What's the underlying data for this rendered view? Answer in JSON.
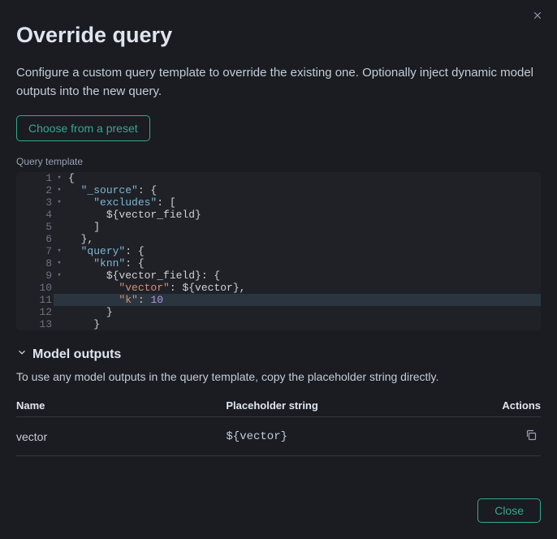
{
  "header": {
    "title": "Override query",
    "description": "Configure a custom query template to override the existing one. Optionally inject dynamic model outputs into the new query.",
    "preset_button_label": "Choose from a preset"
  },
  "editor": {
    "label": "Query template",
    "highlighted_line": 11,
    "lines": [
      {
        "n": 1,
        "foldable": true,
        "indent": 0,
        "tokens": [
          {
            "t": "{",
            "c": "plain"
          }
        ]
      },
      {
        "n": 2,
        "foldable": true,
        "indent": 1,
        "tokens": [
          {
            "t": "\"_source\"",
            "c": "key"
          },
          {
            "t": ": {",
            "c": "plain"
          }
        ]
      },
      {
        "n": 3,
        "foldable": true,
        "indent": 2,
        "tokens": [
          {
            "t": "\"excludes\"",
            "c": "key"
          },
          {
            "t": ": [",
            "c": "plain"
          }
        ]
      },
      {
        "n": 4,
        "foldable": false,
        "indent": 3,
        "tokens": [
          {
            "t": "${vector_field}",
            "c": "plain"
          }
        ]
      },
      {
        "n": 5,
        "foldable": false,
        "indent": 2,
        "tokens": [
          {
            "t": "]",
            "c": "plain"
          }
        ]
      },
      {
        "n": 6,
        "foldable": false,
        "indent": 1,
        "tokens": [
          {
            "t": "},",
            "c": "plain"
          }
        ]
      },
      {
        "n": 7,
        "foldable": true,
        "indent": 1,
        "tokens": [
          {
            "t": "\"query\"",
            "c": "key"
          },
          {
            "t": ": {",
            "c": "plain"
          }
        ]
      },
      {
        "n": 8,
        "foldable": true,
        "indent": 2,
        "tokens": [
          {
            "t": "\"knn\"",
            "c": "key"
          },
          {
            "t": ": {",
            "c": "plain"
          }
        ]
      },
      {
        "n": 9,
        "foldable": true,
        "indent": 3,
        "tokens": [
          {
            "t": "${vector_field}: {",
            "c": "plain"
          }
        ]
      },
      {
        "n": 10,
        "foldable": false,
        "indent": 4,
        "tokens": [
          {
            "t": "\"vector\"",
            "c": "str"
          },
          {
            "t": ": ${vector},",
            "c": "plain"
          }
        ]
      },
      {
        "n": 11,
        "foldable": false,
        "indent": 4,
        "tokens": [
          {
            "t": "\"k\"",
            "c": "str"
          },
          {
            "t": ": ",
            "c": "plain"
          },
          {
            "t": "10",
            "c": "num"
          }
        ]
      },
      {
        "n": 12,
        "foldable": false,
        "indent": 3,
        "tokens": [
          {
            "t": "}",
            "c": "plain"
          }
        ]
      },
      {
        "n": 13,
        "foldable": false,
        "indent": 2,
        "tokens": [
          {
            "t": "}",
            "c": "plain"
          }
        ]
      }
    ]
  },
  "model_outputs": {
    "title": "Model outputs",
    "description": "To use any model outputs in the query template, copy the placeholder string directly.",
    "columns": {
      "name": "Name",
      "placeholder": "Placeholder string",
      "actions": "Actions"
    },
    "rows": [
      {
        "name": "vector",
        "placeholder": "${vector}"
      }
    ]
  },
  "footer": {
    "close_label": "Close"
  }
}
